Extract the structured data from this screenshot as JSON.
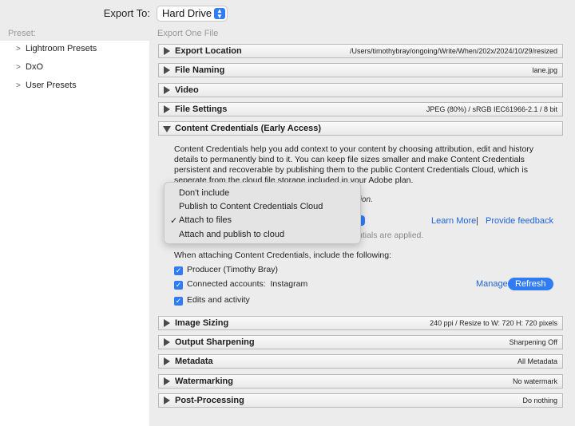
{
  "header": {
    "export_to_label": "Export To:",
    "export_to_value": "Hard Drive",
    "preset_label": "Preset:",
    "subtitle": "Export One File"
  },
  "presets": [
    {
      "label": "Lightroom Presets"
    },
    {
      "label": "DxO"
    },
    {
      "label": "User Presets"
    }
  ],
  "sections": {
    "export_location": {
      "title": "Export Location",
      "summary": "/Users/timothybray/ongoing/Write/When/202x/2024/10/29/resized"
    },
    "file_naming": {
      "title": "File Naming",
      "summary": "lane.jpg"
    },
    "video": {
      "title": "Video",
      "summary": ""
    },
    "file_settings": {
      "title": "File Settings",
      "summary": "JPEG (80%) / sRGB IEC61966-2.1 / 8 bit"
    },
    "content_credentials": {
      "title": "Content Credentials (Early Access)",
      "summary": ""
    },
    "image_sizing": {
      "title": "Image Sizing",
      "summary": "240 ppi / Resize to W: 720 H: 720 pixels"
    },
    "output_sharpening": {
      "title": "Output Sharpening",
      "summary": "Sharpening Off"
    },
    "metadata": {
      "title": "Metadata",
      "summary": "All Metadata"
    },
    "watermarking": {
      "title": "Watermarking",
      "summary": "No watermark"
    },
    "post_processing": {
      "title": "Post-Processing",
      "summary": "Do nothing"
    }
  },
  "credentials": {
    "description": "Content Credentials help you add context to your content by choosing attribution, edit and history details to permanently bind to it. You can keep file sizes smaller and make Content Credentials persistent and recoverable by publishing them to the public Content Credentials Cloud, which is seperate from the cloud file storage included in your Adobe plan.",
    "partial_text_1": "tion.",
    "partial_text_2": "ntials are applied.",
    "learn_more": "Learn More",
    "separator": "|",
    "feedback": "Provide feedback",
    "include_label": "When attaching Content Credentials, include the following:",
    "producer": "Producer (Timothy Bray)",
    "connected_label": "Connected accounts:",
    "connected_value": "Instagram",
    "edits": "Edits and activity",
    "manage": "Manage",
    "refresh": "Refresh"
  },
  "menu": {
    "items": [
      {
        "label": "Don't include",
        "checked": false
      },
      {
        "label": "Publish to Content Credentials Cloud",
        "checked": false
      },
      {
        "label": "Attach to files",
        "checked": true
      },
      {
        "label": "Attach and publish to cloud",
        "checked": false
      }
    ],
    "check_glyph": "✓"
  },
  "colors": {
    "accent": "#2f7cf6",
    "link": "#1f63d6"
  }
}
